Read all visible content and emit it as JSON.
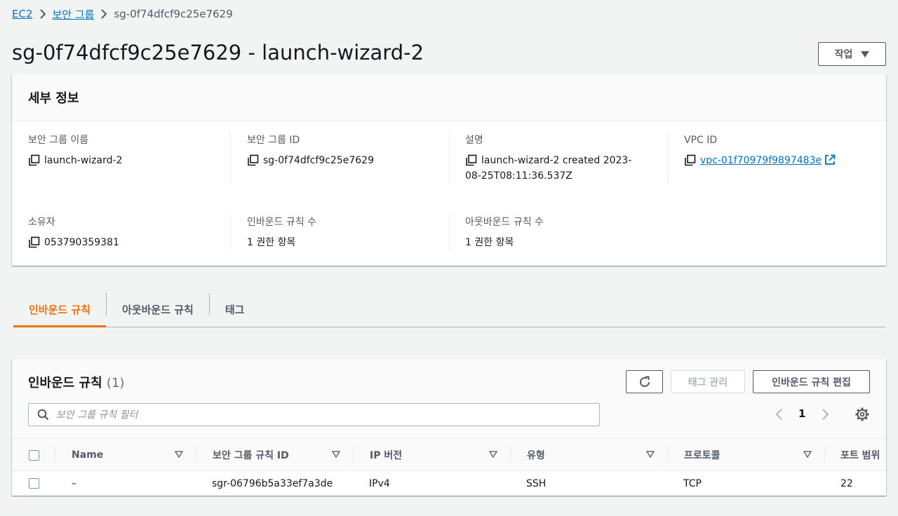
{
  "breadcrumb": {
    "root": "EC2",
    "parent": "보안 그룹",
    "current": "sg-0f74dfcf9c25e7629"
  },
  "header": {
    "title": "sg-0f74dfcf9c25e7629 - launch-wizard-2",
    "actions_label": "작업"
  },
  "details": {
    "title": "세부 정보",
    "fields": {
      "sg_name": {
        "label": "보안 그룹 이름",
        "value": "launch-wizard-2"
      },
      "sg_id": {
        "label": "보안 그룹 ID",
        "value": "sg-0f74dfcf9c25e7629"
      },
      "description": {
        "label": "설명",
        "value": "launch-wizard-2 created 2023-08-25T08:11:36.537Z"
      },
      "vpc_id": {
        "label": "VPC ID",
        "value": "vpc-01f70979f9897483e"
      },
      "owner": {
        "label": "소유자",
        "value": "053790359381"
      },
      "inbound_count": {
        "label": "인바운드 규칙 수",
        "value": "1 권한 항목"
      },
      "outbound_count": {
        "label": "아웃바운드 규칙 수",
        "value": "1 권한 항목"
      }
    }
  },
  "tabs": [
    {
      "label": "인바운드 규칙",
      "active": true
    },
    {
      "label": "아웃바운드 규칙",
      "active": false
    },
    {
      "label": "태그",
      "active": false
    }
  ],
  "inbound": {
    "title": "인바운드 규칙",
    "count": "(1)",
    "manage_tags_label": "태그 관리",
    "edit_label": "인바운드 규칙 편집",
    "search_placeholder": "보안 그룹 규칙 필터",
    "page": "1",
    "columns": [
      "Name",
      "보안 그룹 규칙 ID",
      "IP 버전",
      "유형",
      "프로토콜",
      "포트 범위"
    ],
    "rows": [
      {
        "name": "–",
        "rule_id": "sgr-06796b5a33ef7a3de",
        "ip_version": "IPv4",
        "type": "SSH",
        "protocol": "TCP",
        "port_range": "22"
      }
    ]
  },
  "colors": {
    "link": "#0073bb",
    "accent": "#ec7211",
    "text": "#16191f",
    "muted": "#545b64"
  }
}
